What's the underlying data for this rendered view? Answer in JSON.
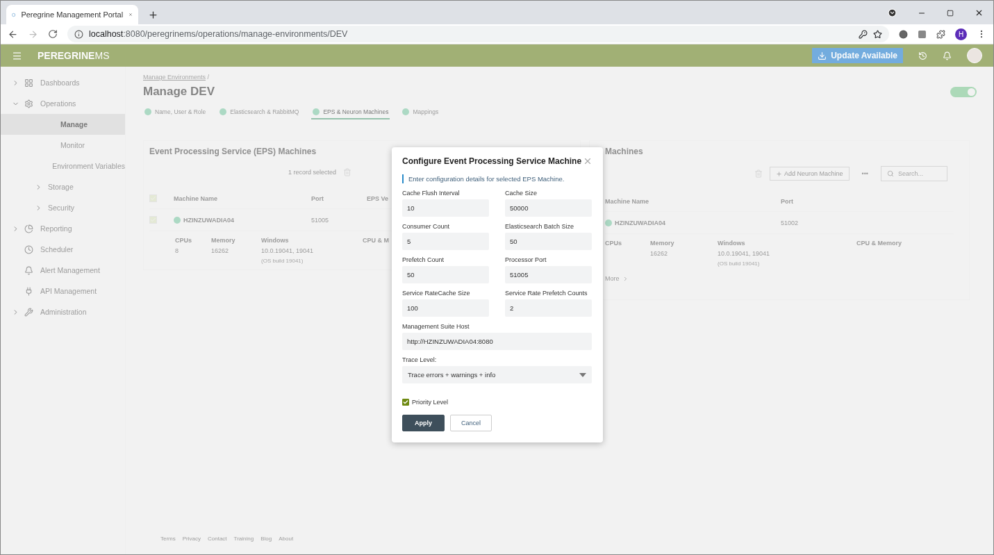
{
  "browser": {
    "tab_title": "Peregrine Management Portal",
    "address_host": "localhost",
    "address_rest": ":8080/peregrinems/operations/manage-environments/DEV",
    "profile_initial": "H"
  },
  "header": {
    "logo_main": "PEREGRINE",
    "logo_tail": "MS",
    "update_button": "Update Available"
  },
  "sidebar": [
    {
      "label": "Dashboards",
      "kind": "group",
      "expanded": false,
      "selected": false
    },
    {
      "label": "Operations",
      "kind": "group",
      "expanded": true,
      "selected": false,
      "children": [
        {
          "label": "Manage",
          "kind": "link",
          "selected": true
        },
        {
          "label": "Monitor",
          "kind": "link",
          "selected": false
        },
        {
          "label": "Environment Variables",
          "kind": "link",
          "selected": false
        },
        {
          "label": "Storage",
          "kind": "group",
          "expanded": false,
          "selected": false
        },
        {
          "label": "Security",
          "kind": "group",
          "expanded": false,
          "selected": false
        }
      ]
    },
    {
      "label": "Reporting",
      "kind": "group",
      "expanded": false,
      "selected": false
    },
    {
      "label": "Scheduler",
      "kind": "link",
      "selected": false
    },
    {
      "label": "Alert Management",
      "kind": "link",
      "selected": false
    },
    {
      "label": "API Management",
      "kind": "link",
      "selected": false
    },
    {
      "label": "Administration",
      "kind": "group",
      "expanded": false,
      "selected": false
    }
  ],
  "page": {
    "breadcrumb": "Manage Environments",
    "breadcrumb_sep": "/",
    "title": "Manage DEV",
    "toggle": {
      "on": true
    },
    "steps": [
      {
        "label": "Name, User & Role",
        "selected": false
      },
      {
        "label": "Elasticsearch & RabbitMQ",
        "selected": false
      },
      {
        "label": "EPS & Neuron Machines",
        "selected": true
      },
      {
        "label": "Mappings",
        "selected": false
      }
    ],
    "left_card": {
      "title": "Event Processing Service (EPS) Machines",
      "selection": "1 record selected",
      "columns": [
        "Machine Name",
        "Port",
        "EPS Ve"
      ],
      "row": {
        "checked": true,
        "name": "HZINZUWADIA04",
        "port": "51005"
      },
      "header_checked": true,
      "details": [
        {
          "label": "CPUs",
          "value": "8"
        },
        {
          "label": "Memory",
          "value": "16262"
        },
        {
          "label": "Windows",
          "value": "10.0.19041, 19041",
          "note": "(OS build 19041)"
        },
        {
          "label": "CPU & M"
        }
      ]
    },
    "right_card": {
      "title": "Machines",
      "add_button": "Add Neuron Machine",
      "more_button": "•••",
      "search_placeholder": "Search...",
      "columns": [
        "Machine Name",
        "Port"
      ],
      "row": {
        "name": "HZINZUWADIA04",
        "port": "51002"
      },
      "details": [
        {
          "label": "CPUs"
        },
        {
          "label": "Memory",
          "value": "16262"
        },
        {
          "label": "Windows",
          "value": "10.0.19041, 19041",
          "note": "(OS build 19041)"
        },
        {
          "label": "CPU & Memory"
        }
      ],
      "more_link": "More"
    },
    "footer": [
      "Terms",
      "Privacy",
      "Contact",
      "Training",
      "Blog",
      "About"
    ]
  },
  "dialog": {
    "title": "Configure Event Processing Service Machine",
    "hint": "Enter configuration details for selected EPS Machine.",
    "fields": [
      {
        "label": "Cache Flush Interval",
        "value": "10",
        "kind": "half"
      },
      {
        "label": "Cache Size",
        "value": "50000",
        "kind": "half"
      },
      {
        "label": "Consumer Count",
        "value": "5",
        "kind": "half"
      },
      {
        "label": "Elasticsearch Batch Size",
        "value": "50",
        "kind": "half"
      },
      {
        "label": "Prefetch Count",
        "value": "50",
        "kind": "half"
      },
      {
        "label": "Processor Port",
        "value": "51005",
        "kind": "half"
      },
      {
        "label": "Service RateCache Size",
        "value": "100",
        "kind": "half"
      },
      {
        "label": "Service Rate Prefetch Counts",
        "value": "2",
        "kind": "half"
      },
      {
        "label": "Management Suite Host",
        "value": "http://HZINZUWADIA04:8080",
        "kind": "full"
      },
      {
        "label": "Trace Level:",
        "value": "Trace errors + warnings + info",
        "kind": "select"
      }
    ],
    "checkbox": {
      "label": "Priority Level",
      "checked": true
    },
    "buttons": [
      {
        "label": "Apply",
        "kind": "primary"
      },
      {
        "label": "Cancel",
        "kind": "secondary"
      }
    ]
  }
}
